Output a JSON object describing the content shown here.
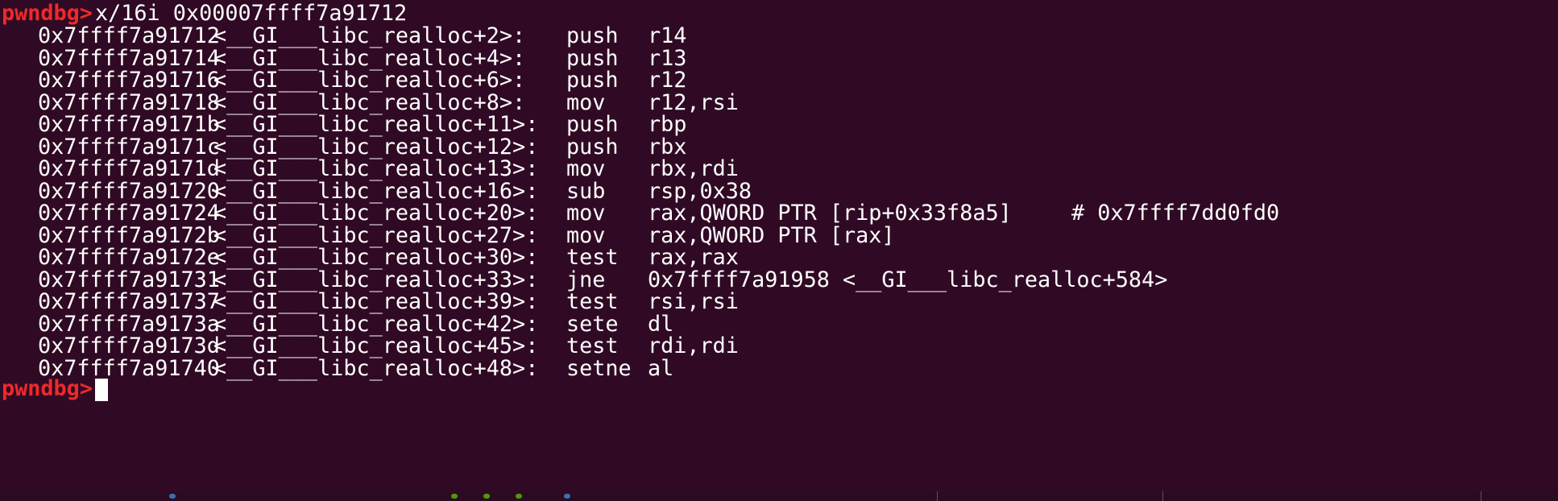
{
  "terminal": {
    "prompt": "pwndbg>",
    "command": "x/16i 0x00007ffff7a91712",
    "instructions": [
      {
        "address": "0x7ffff7a91712",
        "symbol": "<__GI___libc_realloc+2>:",
        "mnemonic": "push",
        "operands": "r14",
        "comment": ""
      },
      {
        "address": "0x7ffff7a91714",
        "symbol": "<__GI___libc_realloc+4>:",
        "mnemonic": "push",
        "operands": "r13",
        "comment": ""
      },
      {
        "address": "0x7ffff7a91716",
        "symbol": "<__GI___libc_realloc+6>:",
        "mnemonic": "push",
        "operands": "r12",
        "comment": ""
      },
      {
        "address": "0x7ffff7a91718",
        "symbol": "<__GI___libc_realloc+8>:",
        "mnemonic": "mov",
        "operands": "r12,rsi",
        "comment": ""
      },
      {
        "address": "0x7ffff7a9171b",
        "symbol": "<__GI___libc_realloc+11>:",
        "mnemonic": "push",
        "operands": "rbp",
        "comment": ""
      },
      {
        "address": "0x7ffff7a9171c",
        "symbol": "<__GI___libc_realloc+12>:",
        "mnemonic": "push",
        "operands": "rbx",
        "comment": ""
      },
      {
        "address": "0x7ffff7a9171d",
        "symbol": "<__GI___libc_realloc+13>:",
        "mnemonic": "mov",
        "operands": "rbx,rdi",
        "comment": ""
      },
      {
        "address": "0x7ffff7a91720",
        "symbol": "<__GI___libc_realloc+16>:",
        "mnemonic": "sub",
        "operands": "rsp,0x38",
        "comment": ""
      },
      {
        "address": "0x7ffff7a91724",
        "symbol": "<__GI___libc_realloc+20>:",
        "mnemonic": "mov",
        "operands": "rax,QWORD PTR [rip+0x33f8a5]",
        "comment": "# 0x7ffff7dd0fd0"
      },
      {
        "address": "0x7ffff7a9172b",
        "symbol": "<__GI___libc_realloc+27>:",
        "mnemonic": "mov",
        "operands": "rax,QWORD PTR [rax]",
        "comment": ""
      },
      {
        "address": "0x7ffff7a9172e",
        "symbol": "<__GI___libc_realloc+30>:",
        "mnemonic": "test",
        "operands": "rax,rax",
        "comment": ""
      },
      {
        "address": "0x7ffff7a91731",
        "symbol": "<__GI___libc_realloc+33>:",
        "mnemonic": "jne",
        "operands": "0x7ffff7a91958 <__GI___libc_realloc+584>",
        "comment": ""
      },
      {
        "address": "0x7ffff7a91737",
        "symbol": "<__GI___libc_realloc+39>:",
        "mnemonic": "test",
        "operands": "rsi,rsi",
        "comment": ""
      },
      {
        "address": "0x7ffff7a9173a",
        "symbol": "<__GI___libc_realloc+42>:",
        "mnemonic": "sete",
        "operands": "dl",
        "comment": ""
      },
      {
        "address": "0x7ffff7a9173d",
        "symbol": "<__GI___libc_realloc+45>:",
        "mnemonic": "test",
        "operands": "rdi,rdi",
        "comment": ""
      },
      {
        "address": "0x7ffff7a91740",
        "symbol": "<__GI___libc_realloc+48>:",
        "mnemonic": "setne",
        "operands": "al",
        "comment": ""
      }
    ]
  },
  "colors": {
    "background": "#300a24",
    "prompt": "#ef2929",
    "text": "#ffffff"
  }
}
